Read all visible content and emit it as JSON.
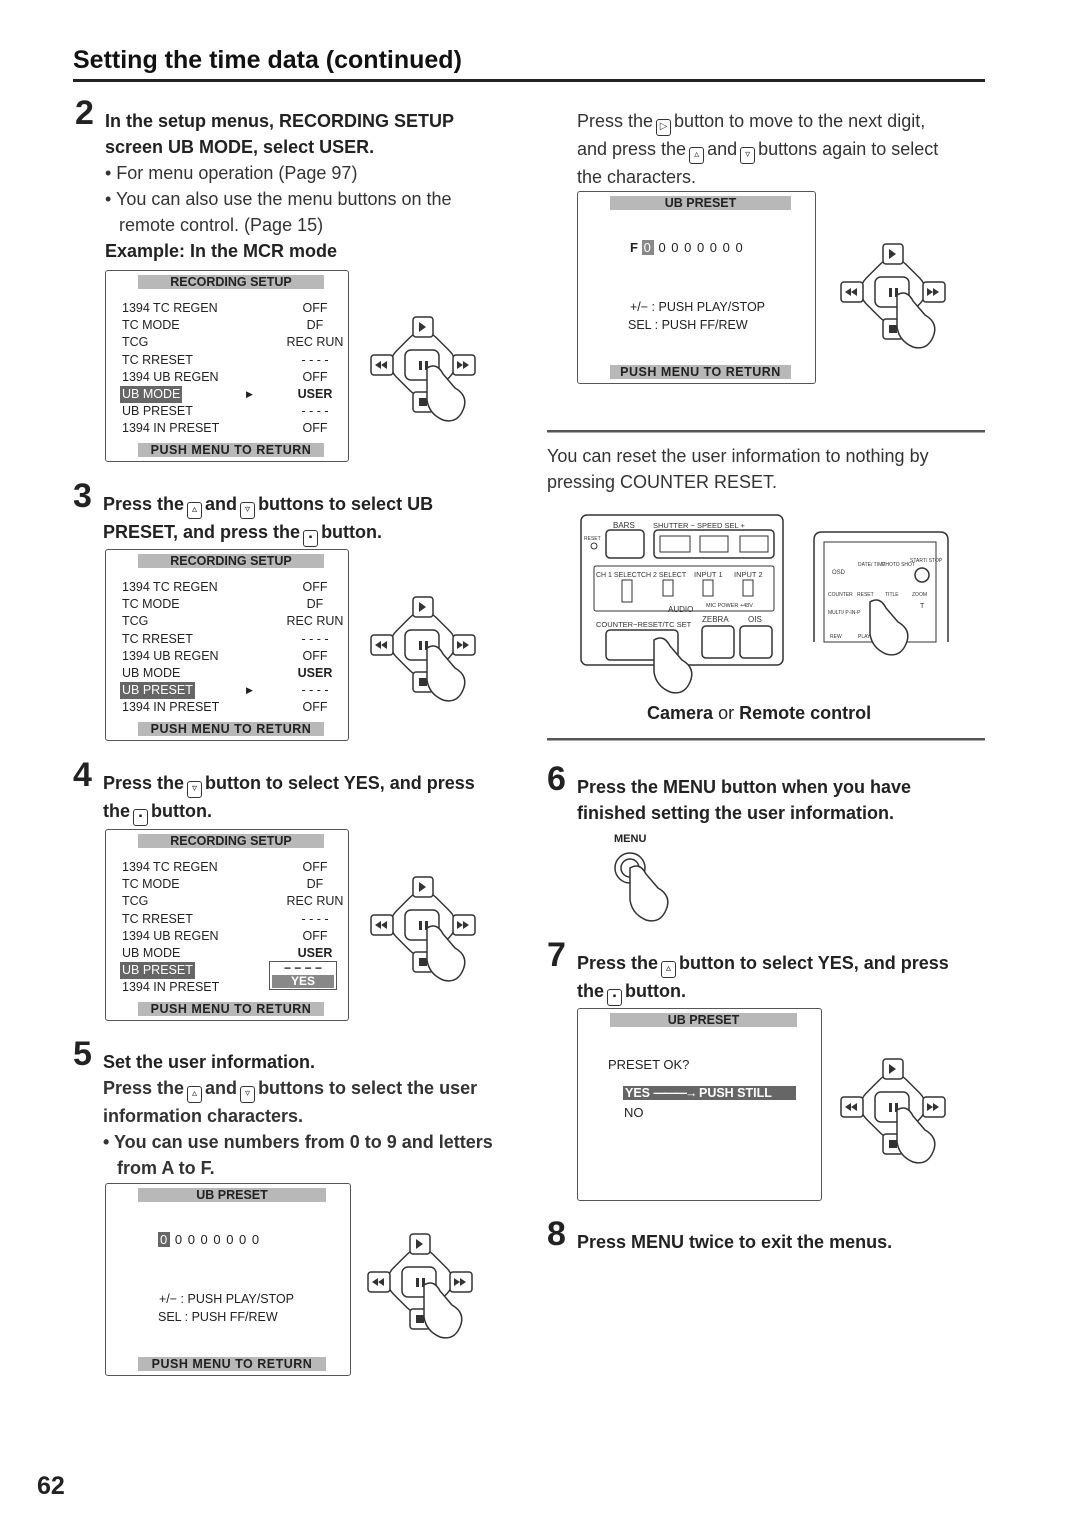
{
  "page": {
    "title": "Setting the time data (continued)",
    "number": "62"
  },
  "step2": {
    "num": "2",
    "line1": "In the setup menus, RECORDING SETUP",
    "line2": "screen UB MODE, select USER.",
    "b1": "• For menu operation (Page 97)",
    "b2": "• You can also use the menu buttons on the",
    "b2b": "remote control. (Page 15)",
    "example": "Example: In the MCR mode"
  },
  "step3": {
    "num": "3",
    "t1": "Press the",
    "t2": "and",
    "t3": "buttons to select UB",
    "t4": "PRESET, and press the",
    "t5": "button."
  },
  "step4": {
    "num": "4",
    "t1": "Press the",
    "t2": "button to select YES, and press",
    "t3": "the",
    "t4": "button."
  },
  "step5": {
    "num": "5",
    "title": "Set the user information.",
    "t1": "Press the",
    "t2": "and",
    "t3": "buttons to select the user",
    "t4": "information characters.",
    "b1": "• You can use numbers from 0 to 9 and letters",
    "b1b": "from A to F."
  },
  "right_top": {
    "t1": "Press the",
    "t2": "button to move to the next digit,",
    "t3": "and press the",
    "t4": "and",
    "t5": "buttons again to select",
    "t6": "the characters."
  },
  "reset": {
    "t1": "You can reset the user information to nothing by",
    "t2": "pressing COUNTER RESET.",
    "cap1": "Camera",
    "cap2": "or",
    "cap3": "Remote control"
  },
  "camera": {
    "bars": "BARS",
    "shutter": "SHUTTER − SPEED SEL +",
    "reset": "RESET",
    "ch1": "CH 1 SELECT",
    "ch2": "CH 2 SELECT",
    "in1": "INPUT 1",
    "in2": "INPUT 2",
    "audio": "AUDIO",
    "mic": "MIC POWER +48V",
    "counter": "COUNTER−RESET/TC SET",
    "zebra": "ZEBRA",
    "ois": "OIS"
  },
  "remote": {
    "osd": "OSD",
    "date": "DATE/ TIME",
    "photo": "PHOTO SHOT",
    "start": "START/ STOP",
    "counter": "COUNTER",
    "reset": "RESET",
    "title": "TITLE",
    "zoom": "ZOOM",
    "t": "T",
    "multi": "MULTI/ P-IN-P",
    "rew": "REW",
    "play": "PLAY"
  },
  "step6": {
    "num": "6",
    "line1": "Press the MENU button when you have",
    "line2": "finished setting the user information.",
    "menu_label": "MENU"
  },
  "step7": {
    "num": "7",
    "t1": "Press the",
    "t2": "button to select YES, and press",
    "t3": "the",
    "t4": "button."
  },
  "step8": {
    "num": "8",
    "text": "Press MENU twice to exit the menus."
  },
  "rec_menu": {
    "title": "RECORDING  SETUP",
    "footer": "PUSH  MENU  TO  RETURN",
    "rows": [
      [
        "1394 TC REGEN",
        "OFF"
      ],
      [
        "TC MODE",
        "DF"
      ],
      [
        "TCG",
        "REC RUN"
      ],
      [
        "TC RRESET",
        "- - - -"
      ],
      [
        "1394 UB REGEN",
        "OFF"
      ],
      [
        "UB MODE",
        "USER"
      ],
      [
        "UB PRESET",
        "- - - -"
      ],
      [
        "1394 IN PRESET",
        "OFF"
      ]
    ],
    "menu3_popup": [
      "− − − −",
      "YES"
    ]
  },
  "ub_preset": {
    "title": "UB  PRESET",
    "footer": "PUSH  MENU  TO  RETURN",
    "digits5": "0 0 0 0 0 0 0 0",
    "digits_r_prefix": "F",
    "digits_r": "0 0 0 0 0 0 0",
    "help1": "+/−  : PUSH  PLAY/STOP",
    "help2": "SEL : PUSH  FF/REW",
    "ok": "PRESET  OK?",
    "yes": "YES",
    "yes_action": "PUSH  STILL",
    "no": "NO"
  },
  "colors": {
    "highlight": "#666666",
    "header_bar": "#b8b8b8"
  },
  "icons": {
    "right": "play-right-button-icon",
    "up": "up-button-icon",
    "down": "down-button-icon",
    "stop": "stop-button-icon"
  }
}
